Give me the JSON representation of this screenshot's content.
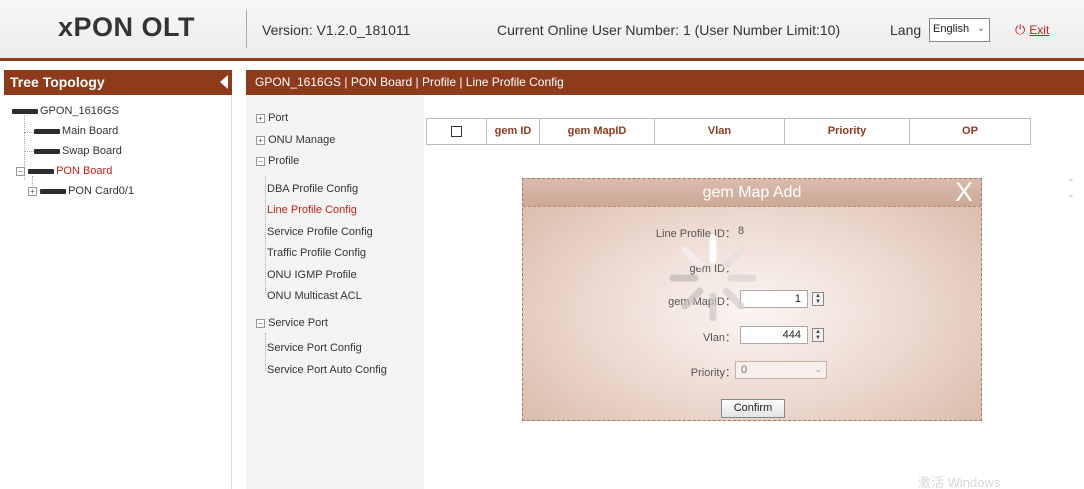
{
  "header": {
    "logo": "xPON OLT",
    "version": "Version: V1.2.0_181011",
    "online": "Current Online User Number: 1 (User Number Limit:10)",
    "lang_label": "Lang",
    "lang_value": "English",
    "exit_label": "Exit",
    "brand_color": "#8e3b1c",
    "active_color": "#c8201a"
  },
  "tree": {
    "title": "Tree Topology",
    "items": [
      {
        "label": "GPON_1616GS"
      },
      {
        "label": "Main Board"
      },
      {
        "label": "Swap Board"
      },
      {
        "label": "PON Board"
      },
      {
        "label": "PON Card0/1"
      }
    ]
  },
  "breadcrumb": "GPON_1616GS | PON Board | Profile | Line Profile Config",
  "menu": {
    "port": "Port",
    "onu_manage": "ONU Manage",
    "profile": "Profile",
    "profile_items": [
      "DBA Profile Config",
      "Line Profile Config",
      "Service Profile Config",
      "Traffic Profile Config",
      "ONU IGMP Profile",
      "ONU Multicast ACL"
    ],
    "service_port": "Service Port",
    "service_items": [
      "Service Port Config",
      "Service Port Auto Config"
    ]
  },
  "table": {
    "headers": [
      "gem ID",
      "gem MapID",
      "Vlan",
      "Priority",
      "OP"
    ]
  },
  "modal": {
    "title": "gem Map Add",
    "close": "X",
    "line_profile_label": "Line Profile ID：",
    "line_profile_value": "8",
    "gem_id_label": "gem ID：",
    "gem_mapid_label": "gem MapID：",
    "gem_mapid_value": "1",
    "vlan_label": "Vlan：",
    "vlan_value": "444",
    "priority_label": "Priority：",
    "priority_value": "0",
    "confirm": "Confirm"
  },
  "watermark": "激活 Windows"
}
